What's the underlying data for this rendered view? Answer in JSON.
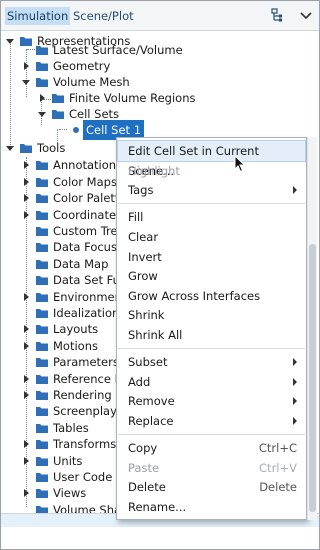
{
  "tabs": [
    {
      "label": "Simulation"
    },
    {
      "label": "Scene/Plot"
    }
  ],
  "toolbar": {
    "tree_view_icon": "tree-view-icon",
    "dropdown_icon": "chevron-down-icon"
  },
  "tree": {
    "items": [
      {
        "label": "Representations"
      },
      {
        "label": "Latest Surface/Volume"
      },
      {
        "label": "Geometry"
      },
      {
        "label": "Volume Mesh"
      },
      {
        "label": "Finite Volume Regions"
      },
      {
        "label": "Cell Sets"
      },
      {
        "label": "Cell Set 1"
      },
      {
        "label": "Tools"
      },
      {
        "label": "Annotations"
      },
      {
        "label": "Color Maps"
      },
      {
        "label": "Color Palettes"
      },
      {
        "label": "Coordinate Systems"
      },
      {
        "label": "Custom Tree"
      },
      {
        "label": "Data Focus"
      },
      {
        "label": "Data Map"
      },
      {
        "label": "Data Set Functions"
      },
      {
        "label": "Environment"
      },
      {
        "label": "Idealization"
      },
      {
        "label": "Layouts"
      },
      {
        "label": "Motions"
      },
      {
        "label": "Parameters"
      },
      {
        "label": "Reference Frames"
      },
      {
        "label": "Rendering"
      },
      {
        "label": "Screenplays"
      },
      {
        "label": "Tables"
      },
      {
        "label": "Transforms"
      },
      {
        "label": "Units"
      },
      {
        "label": "User Code"
      },
      {
        "label": "Views"
      },
      {
        "label": "Volume Shapes"
      }
    ]
  },
  "context_menu": {
    "items": [
      {
        "label": "Edit Cell Set in Current Scene..."
      },
      {
        "label": "Highlight"
      },
      {
        "label": "Tags"
      },
      {
        "label": "Fill"
      },
      {
        "label": "Clear"
      },
      {
        "label": "Invert"
      },
      {
        "label": "Grow"
      },
      {
        "label": "Grow Across Interfaces"
      },
      {
        "label": "Shrink"
      },
      {
        "label": "Shrink All"
      },
      {
        "label": "Subset"
      },
      {
        "label": "Add"
      },
      {
        "label": "Remove"
      },
      {
        "label": "Replace"
      },
      {
        "label": "Copy",
        "shortcut": "Ctrl+C"
      },
      {
        "label": "Paste",
        "shortcut": "Ctrl+V"
      },
      {
        "label": "Delete",
        "shortcut": "Delete"
      },
      {
        "label": "Rename..."
      }
    ]
  },
  "colors": {
    "folder": "#2f6fb5",
    "selection": "#1f6fc3",
    "tab_active": "#c5def3",
    "menu_highlight": "#e3eef9"
  }
}
